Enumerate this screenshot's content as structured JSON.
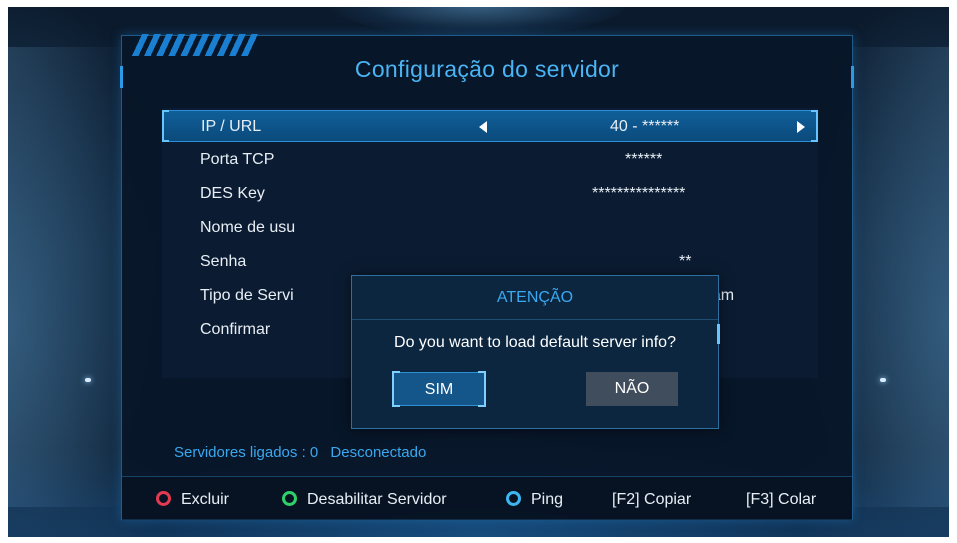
{
  "header": {
    "title": "Configuração do servidor"
  },
  "settings": [
    {
      "label": "IP / URL",
      "value": "40 - ******",
      "selected": true
    },
    {
      "label": "Porta TCP",
      "value": "******"
    },
    {
      "label": "DES Key",
      "value": "***************"
    },
    {
      "label": "Nome de usu",
      "value": ""
    },
    {
      "label": "Senha",
      "value": "**"
    },
    {
      "label": "Tipo de Servi",
      "value": "/Gscam"
    },
    {
      "label": "Confirmar",
      "value": ""
    }
  ],
  "dialog": {
    "title": "ATENÇÃO",
    "message": "Do you want to load default server info?",
    "yes_label": "SIM",
    "no_label": "NÃO"
  },
  "status": {
    "connected_label": "Servidores ligados : 0",
    "connection_state": "Desconectado"
  },
  "footer": {
    "delete": {
      "label": "Excluir",
      "color": "#e23a52"
    },
    "disable": {
      "label": "Desabilitar Servidor",
      "color": "#2fd06a"
    },
    "ping": {
      "label": "Ping",
      "color": "#3db5f0"
    },
    "copy": {
      "key": "[F2]",
      "label": "Copiar"
    },
    "paste": {
      "key": "[F3]",
      "label": "Colar"
    }
  },
  "colors": {
    "accent": "#3aa8f0",
    "panel": "#081628",
    "selected": "#0f5f9a"
  }
}
